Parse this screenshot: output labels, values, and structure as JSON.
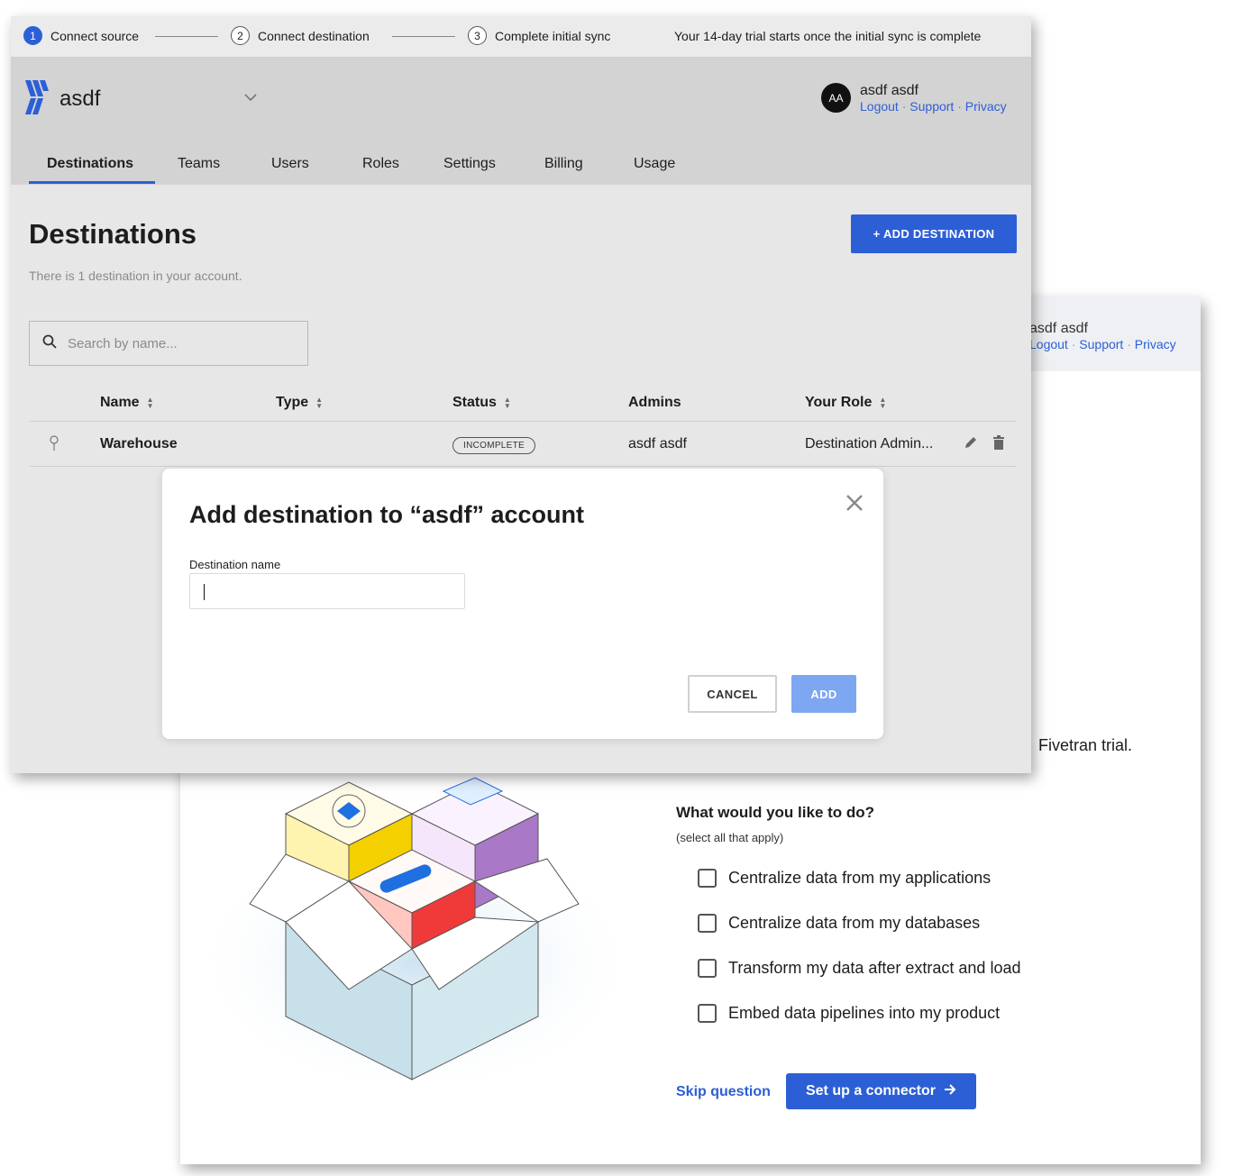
{
  "background_page": {
    "user_name": "asdf asdf",
    "links": [
      "Logout",
      "Support",
      "Privacy"
    ],
    "trial_text": "Fivetran trial.",
    "question": "What would you like to do?",
    "question_hint": "(select all that apply)",
    "options": [
      "Centralize data from my applications",
      "Centralize data from my databases",
      "Transform my data after extract and load",
      "Embed data pipelines into my product"
    ],
    "skip_label": "Skip question",
    "setup_label": "Set up a connector"
  },
  "steps": [
    {
      "num": "1",
      "label": "Connect source"
    },
    {
      "num": "2",
      "label": "Connect destination"
    },
    {
      "num": "3",
      "label": "Complete initial sync"
    }
  ],
  "trial_note": "Your 14-day trial starts once the initial sync is complete",
  "account": {
    "name": "asdf"
  },
  "user": {
    "initials": "AA",
    "name": "asdf asdf",
    "links": [
      "Logout",
      "Support",
      "Privacy"
    ]
  },
  "nav_tabs": [
    "Destinations",
    "Teams",
    "Users",
    "Roles",
    "Settings",
    "Billing",
    "Usage"
  ],
  "page": {
    "title": "Destinations",
    "subtitle": "There is 1 destination in your account.",
    "add_button": "+ ADD DESTINATION",
    "search_placeholder": "Search by name..."
  },
  "table": {
    "columns": [
      "Name",
      "Type",
      "Status",
      "Admins",
      "Your Role"
    ],
    "rows": [
      {
        "name": "Warehouse",
        "type": "",
        "status": "INCOMPLETE",
        "admins": "asdf asdf",
        "role": "Destination Admin..."
      }
    ]
  },
  "modal": {
    "title": "Add destination to “asdf” account",
    "field_label": "Destination name",
    "field_value": "",
    "cancel_label": "CANCEL",
    "add_label": "ADD"
  },
  "colors": {
    "accent": "#2c5fd6",
    "add_disabled": "#7ea7f2"
  }
}
